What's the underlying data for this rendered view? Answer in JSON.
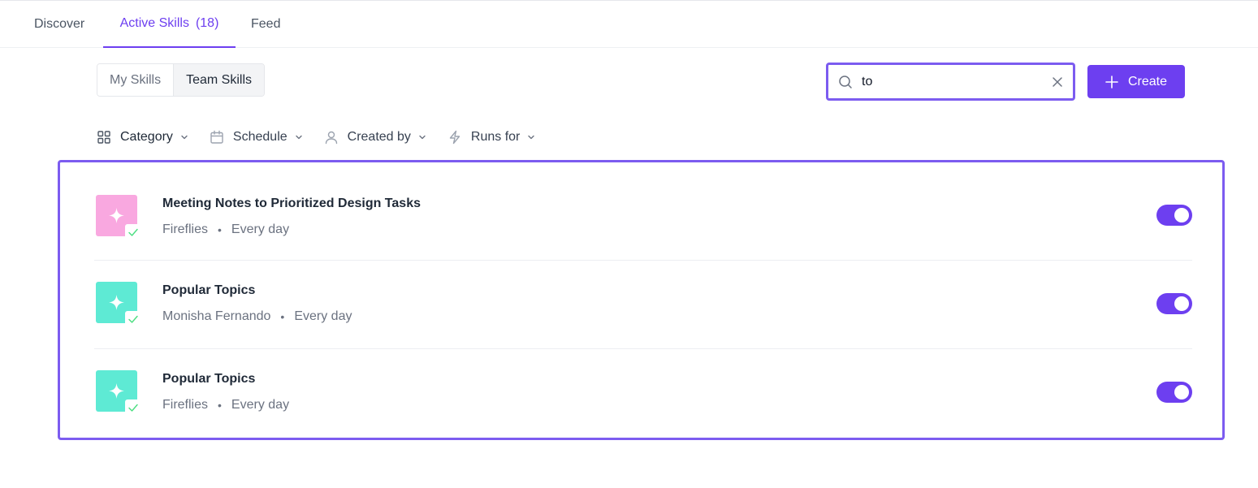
{
  "nav": {
    "tabs": [
      {
        "label": "Discover"
      },
      {
        "label": "Active Skills",
        "count": "(18)"
      },
      {
        "label": "Feed"
      }
    ]
  },
  "scope": {
    "options": [
      "My Skills",
      "Team Skills"
    ],
    "selected": "Team Skills"
  },
  "search": {
    "value": "to"
  },
  "toolbar": {
    "create_label": "Create"
  },
  "filters": [
    {
      "label": "Category",
      "icon": "grid-icon"
    },
    {
      "label": "Schedule",
      "icon": "calendar-icon"
    },
    {
      "label": "Created by",
      "icon": "user-icon"
    },
    {
      "label": "Runs for",
      "icon": "lightning-icon"
    }
  ],
  "skills": [
    {
      "title": "Meeting Notes to Prioritized Design Tasks",
      "source": "Fireflies",
      "schedule": "Every day",
      "thumb_color": "#f9a8e0",
      "enabled": true
    },
    {
      "title": "Popular Topics",
      "source": "Monisha Fernando",
      "schedule": "Every day",
      "thumb_color": "#5eead4",
      "enabled": true
    },
    {
      "title": "Popular Topics",
      "source": "Fireflies",
      "schedule": "Every day",
      "thumb_color": "#5eead4",
      "enabled": true
    }
  ],
  "colors": {
    "accent": "#6d3ff0",
    "check": "#4ade80"
  }
}
